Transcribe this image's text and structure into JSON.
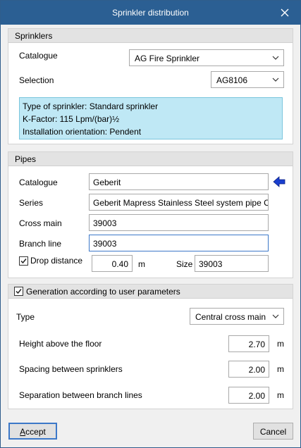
{
  "window": {
    "title": "Sprinkler distribution"
  },
  "sprinklers": {
    "header": "Sprinklers",
    "catalogue_label": "Catalogue",
    "catalogue_value": "AG Fire Sprinkler",
    "selection_label": "Selection",
    "selection_value": "AG8106",
    "info": {
      "type": "Type of sprinkler: Standard sprinkler",
      "kfactor": "K-Factor: 115 Lpm/(bar)½",
      "orientation": "Installation orientation: Pendent"
    }
  },
  "pipes": {
    "header": "Pipes",
    "catalogue_label": "Catalogue",
    "catalogue_value": "Geberit",
    "series_label": "Series",
    "series_value": "Geberit Mapress Stainless Steel system pipe CrN",
    "cross_main_label": "Cross main",
    "cross_main_value": "39003",
    "branch_line_label": "Branch line",
    "branch_line_value": "39003",
    "drop_distance_label": "Drop distance",
    "drop_distance_checked": true,
    "drop_distance_value": "0.40",
    "drop_distance_unit": "m",
    "size_label": "Size",
    "size_value": "39003"
  },
  "generation": {
    "header": "Generation according to user parameters",
    "checked": true,
    "type_label": "Type",
    "type_value": "Central cross main",
    "height_label": "Height above the floor",
    "height_value": "2.70",
    "height_unit": "m",
    "spacing_label": "Spacing between sprinklers",
    "spacing_value": "2.00",
    "spacing_unit": "m",
    "separation_label": "Separation between branch lines",
    "separation_value": "2.00",
    "separation_unit": "m"
  },
  "buttons": {
    "accept_mnemonic": "A",
    "accept_rest": "ccept",
    "cancel": "Cancel"
  },
  "colors": {
    "titlebar": "#2b5f93",
    "info_bg": "#bfe8f5",
    "pick_arrow": "#1a3fcf"
  }
}
